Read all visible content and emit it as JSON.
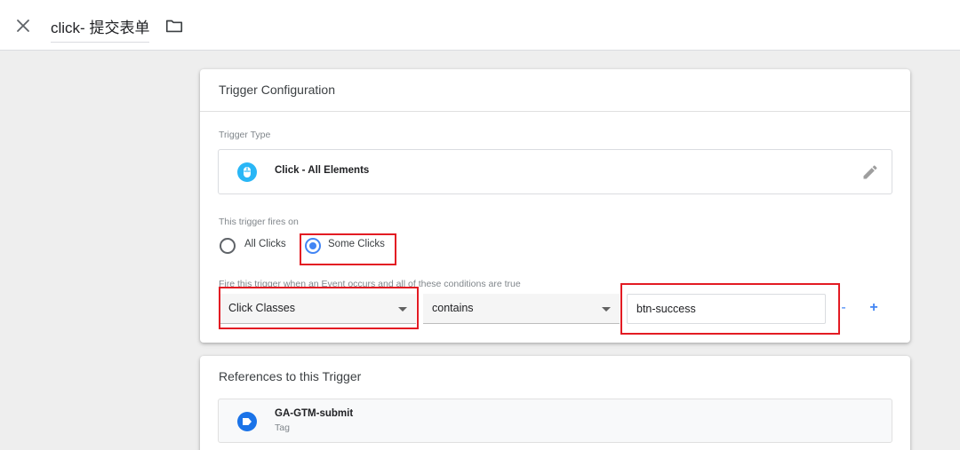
{
  "header": {
    "title": "click- 提交表单",
    "close_icon": "close-icon",
    "folder_icon": "folder-icon"
  },
  "config": {
    "heading": "Trigger Configuration",
    "trigger_type_label": "Trigger Type",
    "trigger_type": "Click - All Elements",
    "trigger_type_icon": "mouse-icon",
    "fires_on_label": "This trigger fires on",
    "options": [
      {
        "label": "All Clicks",
        "selected": false
      },
      {
        "label": "Some Clicks",
        "selected": true
      }
    ],
    "conditions_label": "Fire this trigger when an Event occurs and all of these conditions are true",
    "condition": {
      "variable": "Click Classes",
      "operator": "contains",
      "value": "btn-success"
    },
    "remove_label": "-",
    "add_label": "+"
  },
  "references": {
    "heading": "References to this Trigger",
    "items": [
      {
        "name": "GA-GTM-submit",
        "kind": "Tag",
        "icon": "tag-icon"
      }
    ]
  },
  "colors": {
    "accent": "#4285f4",
    "highlight": "#e31b23",
    "trigger_icon": "#29b6f6",
    "tag_icon": "#1a73e8"
  }
}
